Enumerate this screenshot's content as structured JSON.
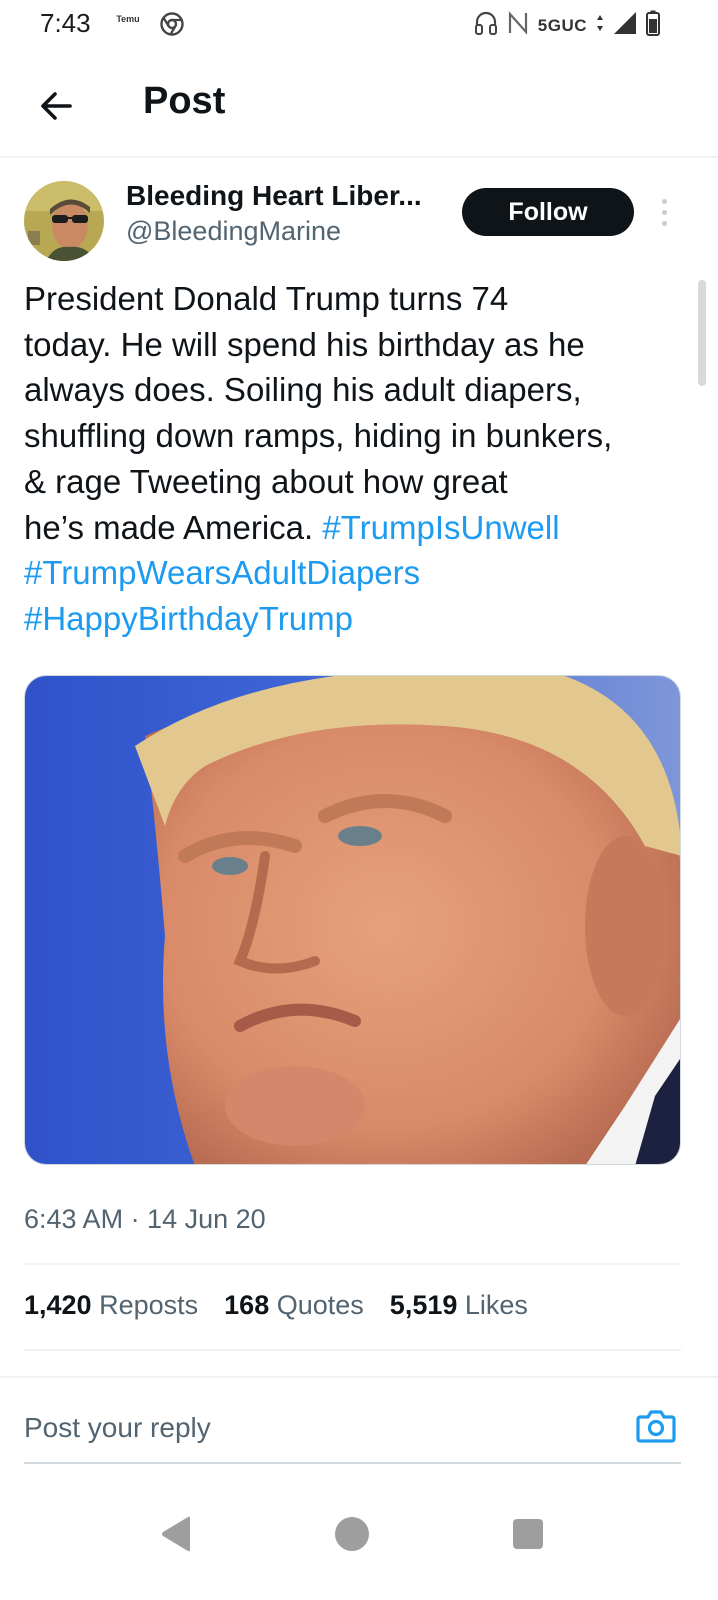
{
  "status_bar": {
    "time": "7:43",
    "temu_badge": "Temu",
    "network": "5GUC"
  },
  "header": {
    "title": "Post"
  },
  "author": {
    "display_name": "Bleeding Heart Liber...",
    "handle": "@BleedingMarine",
    "follow_label": "Follow"
  },
  "tweet": {
    "lines": [
      "President Donald Trump turns 74",
      "today. He will spend his birthday as he",
      "always does. Soiling his adult diapers,",
      "shuffling down ramps, hiding in bunkers,",
      "& rage Tweeting about how great",
      "he’s made America. "
    ],
    "hashtags": [
      "#TrumpIsUnwell",
      "#TrumpWearsAdultDiapers",
      "#HappyBirthdayTrump"
    ],
    "timestamp": "6:43 AM · 14 Jun 20"
  },
  "stats": {
    "reposts_count": "1,420",
    "reposts_label": "Reposts",
    "quotes_count": "168",
    "quotes_label": "Quotes",
    "likes_count": "5,519",
    "likes_label": "Likes"
  },
  "reply": {
    "placeholder": "Post your reply"
  },
  "colors": {
    "link": "#1d9bf0",
    "follow_bg": "#0f1419",
    "secondary_text": "#536471"
  },
  "icons": {
    "back": "arrow-left-icon",
    "more": "more-vertical-icon",
    "camera": "camera-icon",
    "nav_back": "triangle-back-icon",
    "nav_home": "circle-home-icon",
    "nav_recents": "square-recents-icon"
  }
}
